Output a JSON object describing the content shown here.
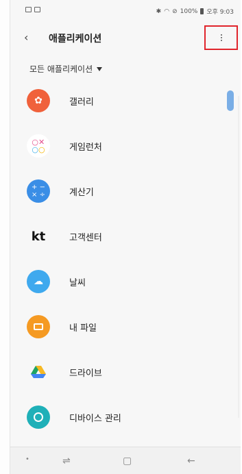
{
  "status_bar": {
    "right_text": "100%",
    "time": "오후 9:03"
  },
  "app_bar": {
    "title": "애플리케이션"
  },
  "filter": {
    "label": "모든 애플리케이션"
  },
  "apps": [
    {
      "label": "갤러리",
      "icon": "gallery-icon"
    },
    {
      "label": "게임런처",
      "icon": "game-launcher-icon"
    },
    {
      "label": "계산기",
      "icon": "calculator-icon"
    },
    {
      "label": "고객센터",
      "icon": "kt-icon",
      "icon_text": "kt"
    },
    {
      "label": "날씨",
      "icon": "weather-icon"
    },
    {
      "label": "내 파일",
      "icon": "my-files-icon"
    },
    {
      "label": "드라이브",
      "icon": "drive-icon"
    },
    {
      "label": "디바이스 관리",
      "icon": "device-care-icon"
    }
  ],
  "colors": {
    "highlight_border": "#e0242b",
    "scroll_thumb": "#7aaee6"
  }
}
